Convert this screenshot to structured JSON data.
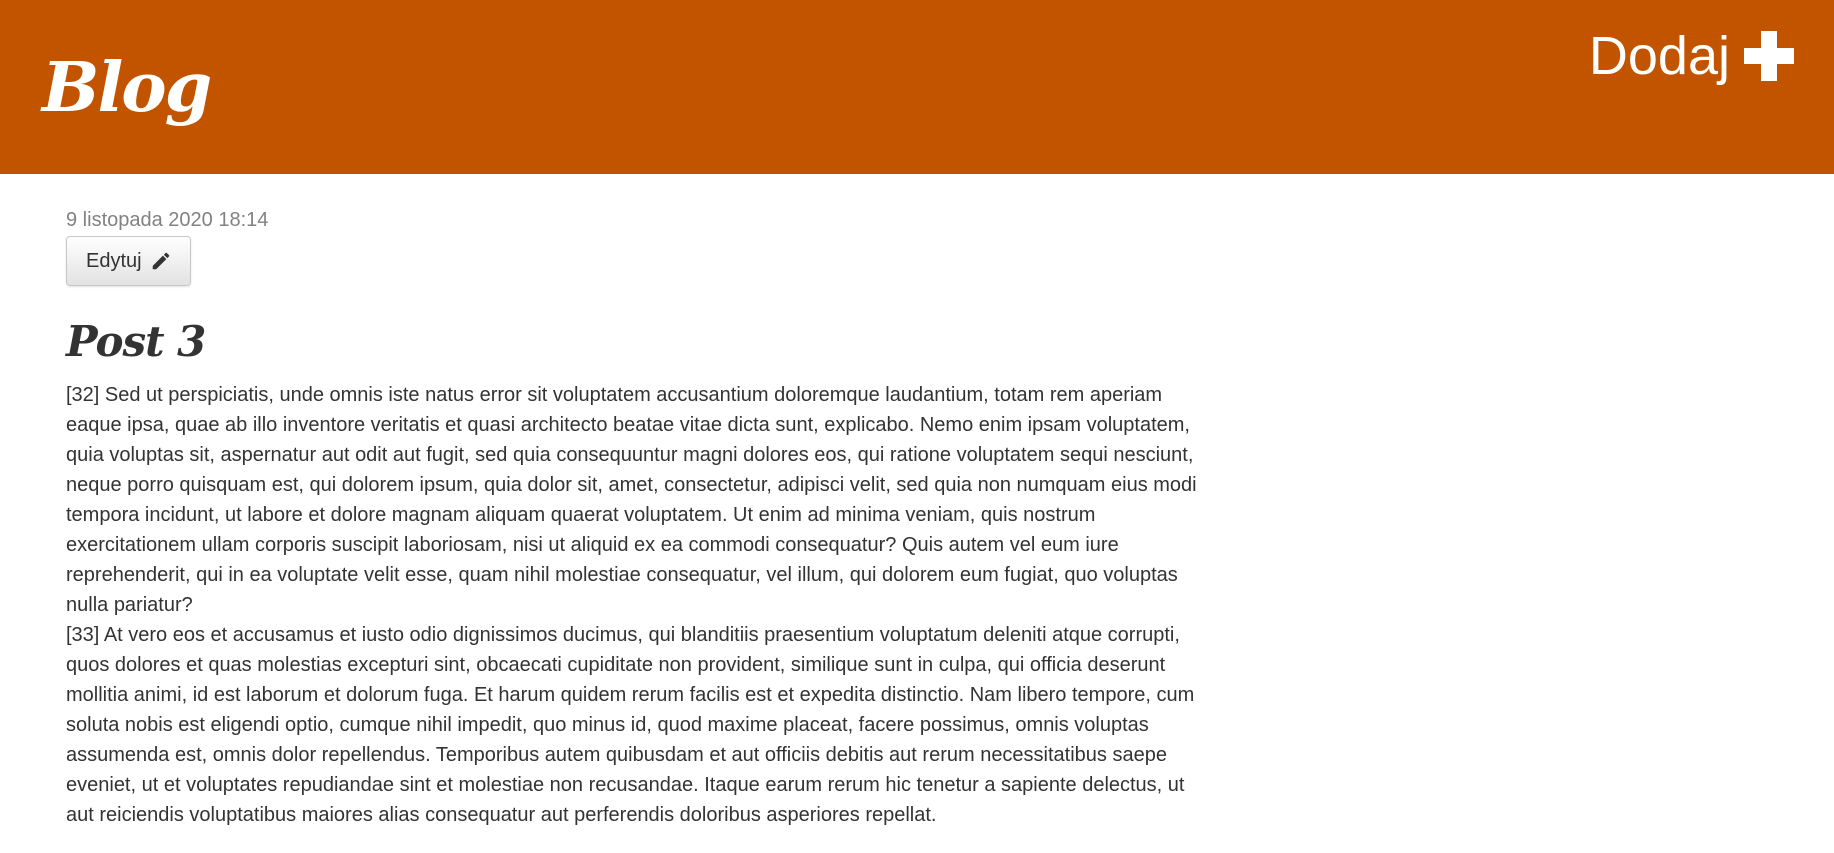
{
  "header": {
    "logo_text": "Blog",
    "add_label": "Dodaj",
    "add_icon": "plus-icon",
    "background_color": "#c25400"
  },
  "post": {
    "date": "9 listopada 2020 18:14",
    "edit_label": "Edytuj",
    "edit_icon": "pencil-icon",
    "title": "Post 3",
    "body": "[32] Sed ut perspiciatis, unde omnis iste natus error sit voluptatem accusantium doloremque laudantium, totam rem aperiam eaque ipsa, quae ab illo inventore veritatis et quasi architecto beatae vitae dicta sunt, explicabo. Nemo enim ipsam voluptatem, quia voluptas sit, aspernatur aut odit aut fugit, sed quia consequuntur magni dolores eos, qui ratione voluptatem sequi nesciunt, neque porro quisquam est, qui dolorem ipsum, quia dolor sit, amet, consectetur, adipisci velit, sed quia non numquam eius modi tempora incidunt, ut labore et dolore magnam aliquam quaerat voluptatem. Ut enim ad minima veniam, quis nostrum exercitationem ullam corporis suscipit laboriosam, nisi ut aliquid ex ea commodi consequatur? Quis autem vel eum iure reprehenderit, qui in ea voluptate velit esse, quam nihil molestiae consequatur, vel illum, qui dolorem eum fugiat, quo voluptas nulla pariatur?\n[33] At vero eos et accusamus et iusto odio dignissimos ducimus, qui blanditiis praesentium voluptatum deleniti atque corrupti, quos dolores et quas molestias excepturi sint, obcaecati cupiditate non provident, similique sunt in culpa, qui officia deserunt mollitia animi, id est laborum et dolorum fuga. Et harum quidem rerum facilis est et expedita distinctio. Nam libero tempore, cum soluta nobis est eligendi optio, cumque nihil impedit, quo minus id, quod maxime placeat, facere possimus, omnis voluptas assumenda est, omnis dolor repellendus. Temporibus autem quibusdam et aut officiis debitis aut rerum necessitatibus saepe eveniet, ut et voluptates repudiandae sint et molestiae non recusandae. Itaque earum rerum hic tenetur a sapiente delectus, ut aut reiciendis voluptatibus maiores alias consequatur aut perferendis doloribus asperiores repellat."
  }
}
